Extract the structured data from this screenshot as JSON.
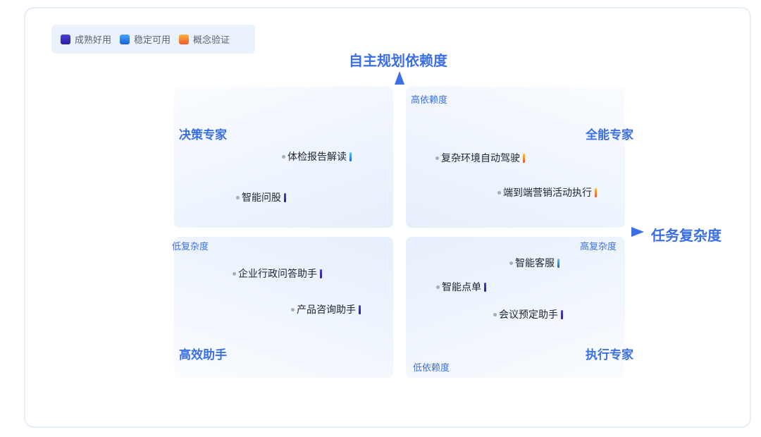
{
  "legend": {
    "items": [
      {
        "label": "成熟好用",
        "color": "#3a2fc0"
      },
      {
        "label": "稳定可用",
        "color": "#2f7cf0"
      },
      {
        "label": "概念验证",
        "color": "#f58a30"
      }
    ]
  },
  "axes": {
    "y_title": "自主规划依赖度",
    "x_title": "任务复杂度",
    "y_high": "高依赖度",
    "y_low": "低依赖度",
    "x_low": "低复杂度",
    "x_high": "高复杂度",
    "accent": "#3b6fe6"
  },
  "quadrants": {
    "top_left": {
      "title": "决策专家",
      "items": [
        {
          "label": "体检报告解读",
          "status": "稳定可用"
        },
        {
          "label": "智能问股",
          "status": "成熟好用"
        }
      ]
    },
    "top_right": {
      "title": "全能专家",
      "items": [
        {
          "label": "复杂环境自动驾驶",
          "status": "概念验证"
        },
        {
          "label": "端到端营销活动执行",
          "status": "概念验证"
        }
      ]
    },
    "bottom_left": {
      "title": "高效助手",
      "items": [
        {
          "label": "企业行政问答助手",
          "status": "成熟好用"
        },
        {
          "label": "产品咨询助手",
          "status": "成熟好用"
        }
      ]
    },
    "bottom_right": {
      "title": "执行专家",
      "items": [
        {
          "label": "智能客服",
          "status": "稳定可用"
        },
        {
          "label": "智能点单",
          "status": "成熟好用"
        },
        {
          "label": "会议预定助手",
          "status": "成熟好用"
        }
      ]
    }
  }
}
